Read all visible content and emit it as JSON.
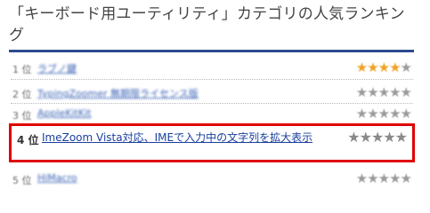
{
  "header": {
    "title": "「キーボード用ユーティリティ」カテゴリの人気ランキング"
  },
  "ranking": [
    {
      "rank": "1 位",
      "name": "ラブノ鍵",
      "stars_on": 4,
      "stars_off": 1
    },
    {
      "rank": "2 位",
      "name": "TypingZoomer 無期限ライセンス版",
      "stars_on": 0,
      "stars_off": 5
    },
    {
      "rank": "3 位",
      "name": "AppleKitKit",
      "stars_on": 0,
      "stars_off": 5
    },
    {
      "rank": "4 位",
      "name": "ImeZoom Vista対応、IMEで入力中の文字列を拡大表示",
      "stars_on": 0,
      "stars_off": 5
    },
    {
      "rank": "5 位",
      "name": "HiMacro",
      "stars_on": 0,
      "stars_off": 5
    }
  ],
  "icons": {
    "star_filled": "★",
    "star_empty": "★"
  },
  "colors": {
    "accent_rule": "#2d4a8e",
    "highlight_border": "#e00000",
    "star_on": "#f0a020",
    "star_off": "#9a9a9a"
  }
}
